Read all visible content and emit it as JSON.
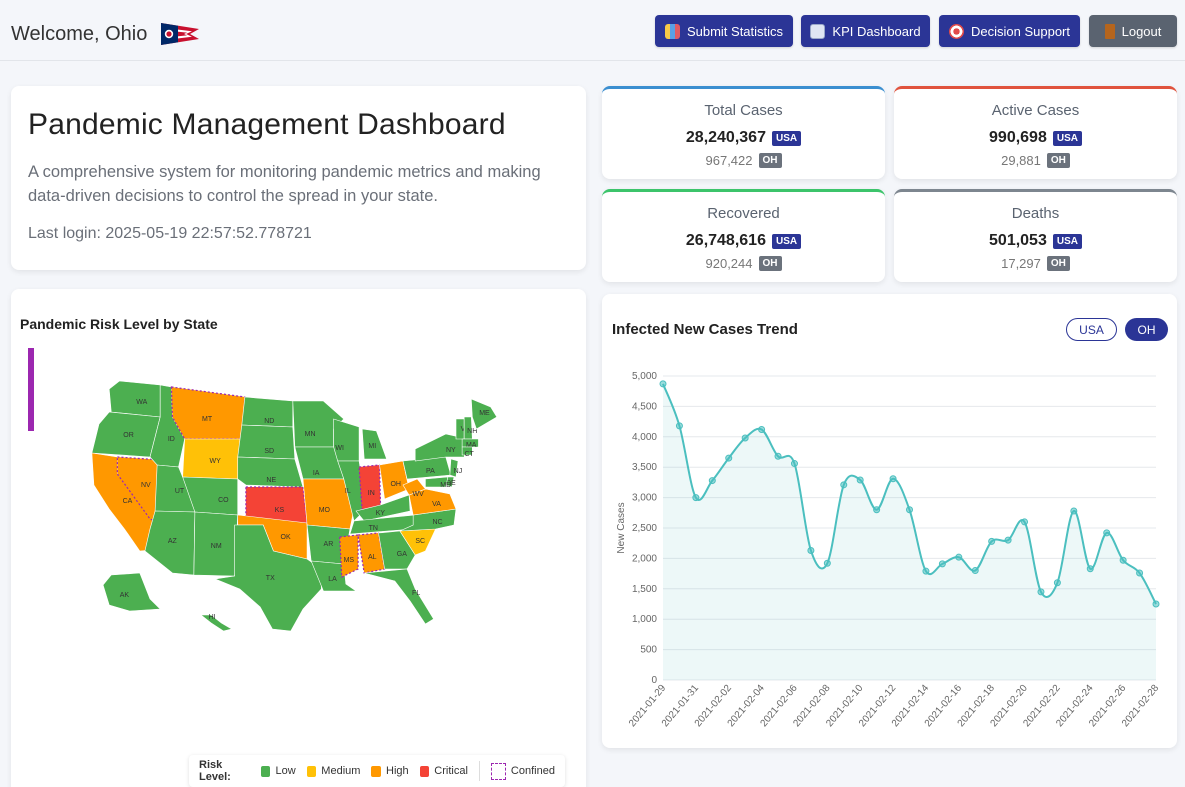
{
  "header": {
    "welcome": "Welcome, Ohio",
    "buttons": {
      "submit": "Submit Statistics",
      "kpi": "KPI Dashboard",
      "decision": "Decision Support",
      "logout": "Logout"
    }
  },
  "hero": {
    "title": "Pandemic Management Dashboard",
    "description": "A comprehensive system for monitoring pandemic metrics and making data-driven decisions to control the spread in your state.",
    "last_login": "Last login: 2025-05-19 22:57:52.778721"
  },
  "stats": [
    {
      "label": "Total Cases",
      "usa": "28,240,367",
      "oh": "967,422",
      "color": "#3b8fd0"
    },
    {
      "label": "Active Cases",
      "usa": "990,698",
      "oh": "29,881",
      "color": "#e0533d"
    },
    {
      "label": "Recovered",
      "usa": "26,748,616",
      "oh": "920,244",
      "color": "#3cc46b"
    },
    {
      "label": "Deaths",
      "usa": "501,053",
      "oh": "17,297",
      "color": "#7d868f"
    }
  ],
  "badges": {
    "usa": "USA",
    "oh": "OH"
  },
  "map": {
    "title": "Pandemic Risk Level by State",
    "legend": {
      "title": "Risk Level:",
      "low": "Low",
      "medium": "Medium",
      "high": "High",
      "critical": "Critical",
      "confined": "Confined"
    },
    "colors": {
      "low": "#4caf50",
      "medium": "#ffc107",
      "high": "#ff9800",
      "critical": "#f44336",
      "confined": "#9c27b0"
    },
    "states": [
      "WA",
      "OR",
      "CA",
      "NV",
      "ID",
      "MT",
      "WY",
      "UT",
      "AZ",
      "CO",
      "NM",
      "ND",
      "SD",
      "NE",
      "KS",
      "OK",
      "TX",
      "MN",
      "IA",
      "MO",
      "AR",
      "LA",
      "WI",
      "IL",
      "MI",
      "IN",
      "OH",
      "KY",
      "TN",
      "MS",
      "AL",
      "GA",
      "FL",
      "SC",
      "NC",
      "VA",
      "WV",
      "PA",
      "NY",
      "VT",
      "NH",
      "ME",
      "MA",
      "CT",
      "NJ",
      "DE",
      "MD",
      "AK",
      "HI"
    ]
  },
  "trend": {
    "title": "Infected New Cases Trend",
    "toggle_usa": "USA",
    "toggle_oh": "OH"
  },
  "chart_data": {
    "type": "line",
    "title": "Infected New Cases Trend",
    "ylabel": "New Cases",
    "xlabel": "",
    "ylim": [
      0,
      5000
    ],
    "yticks": [
      "0",
      "500",
      "1,000",
      "1,500",
      "2,000",
      "2,500",
      "3,000",
      "3,500",
      "4,000",
      "4,500",
      "5,000"
    ],
    "x": [
      "2021-01-29",
      "2021-01-30",
      "2021-01-31",
      "2021-02-01",
      "2021-02-02",
      "2021-02-03",
      "2021-02-04",
      "2021-02-05",
      "2021-02-06",
      "2021-02-07",
      "2021-02-08",
      "2021-02-09",
      "2021-02-10",
      "2021-02-11",
      "2021-02-12",
      "2021-02-13",
      "2021-02-14",
      "2021-02-15",
      "2021-02-16",
      "2021-02-17",
      "2021-02-18",
      "2021-02-19",
      "2021-02-20",
      "2021-02-21",
      "2021-02-22",
      "2021-02-23",
      "2021-02-24",
      "2021-02-25",
      "2021-02-26",
      "2021-02-27",
      "2021-02-28"
    ],
    "xtick_labels": [
      "2021-01-29",
      "2021-01-31",
      "2021-02-02",
      "2021-02-04",
      "2021-02-06",
      "2021-02-08",
      "2021-02-10",
      "2021-02-12",
      "2021-02-14",
      "2021-02-16",
      "2021-02-18",
      "2021-02-20",
      "2021-02-22",
      "2021-02-24",
      "2021-02-26",
      "2021-02-28"
    ],
    "series": [
      {
        "values": [
          4870,
          4180,
          3000,
          3280,
          3650,
          3980,
          4120,
          3680,
          3560,
          2130,
          1920,
          3210,
          3290,
          2800,
          3310,
          2800,
          1790,
          1910,
          2020,
          1800,
          2280,
          2300,
          2600,
          1450,
          1600,
          2780,
          1830,
          2420,
          1970,
          1760,
          1250
        ]
      }
    ],
    "color": "#4bbfbf",
    "grid": true
  }
}
